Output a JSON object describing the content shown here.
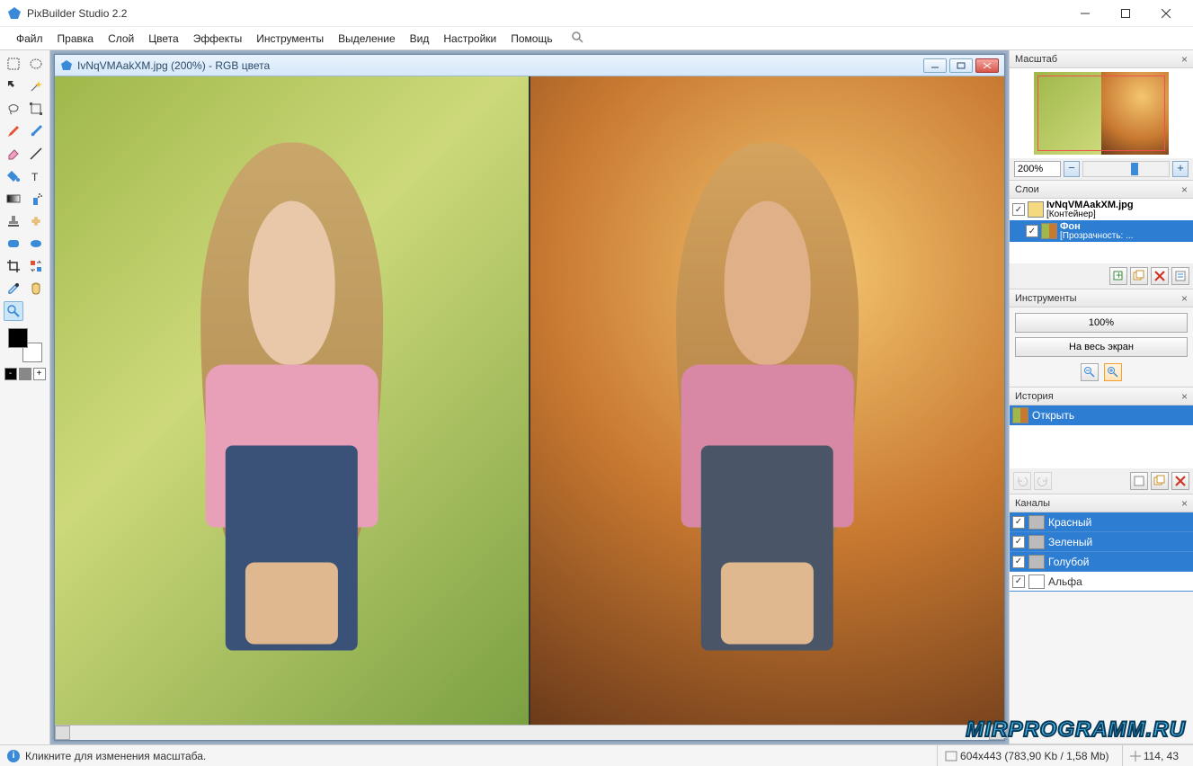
{
  "app": {
    "title": "PixBuilder Studio 2.2"
  },
  "menu": [
    "Файл",
    "Правка",
    "Слой",
    "Цвета",
    "Эффекты",
    "Инструменты",
    "Выделение",
    "Вид",
    "Настройки",
    "Помощь"
  ],
  "document": {
    "title": "IvNqVMAakXM.jpg (200%) - RGB цвета"
  },
  "panels": {
    "navigator": {
      "title": "Масштаб",
      "zoom_value": "200%"
    },
    "layers": {
      "title": "Слои",
      "item0": {
        "name": "IvNqVMAakXM.jpg",
        "sub": "[Контейнер]"
      },
      "item1": {
        "name": "Фон",
        "sub": "[Прозрачность: ..."
      }
    },
    "tools": {
      "title": "Инструменты",
      "btn100": "100%",
      "btnFull": "На весь экран"
    },
    "history": {
      "title": "История",
      "item0": "Открыть"
    },
    "channels": {
      "title": "Каналы",
      "r": "Красный",
      "g": "Зеленый",
      "b": "Голубой",
      "a": "Альфа"
    }
  },
  "status": {
    "hint": "Кликните для изменения масштаба.",
    "dims": "604x443",
    "size": "(783,90 Kb / 1,58 Mb)",
    "coords": "114, 43"
  },
  "watermark": "MIRPROGRAMM.RU"
}
